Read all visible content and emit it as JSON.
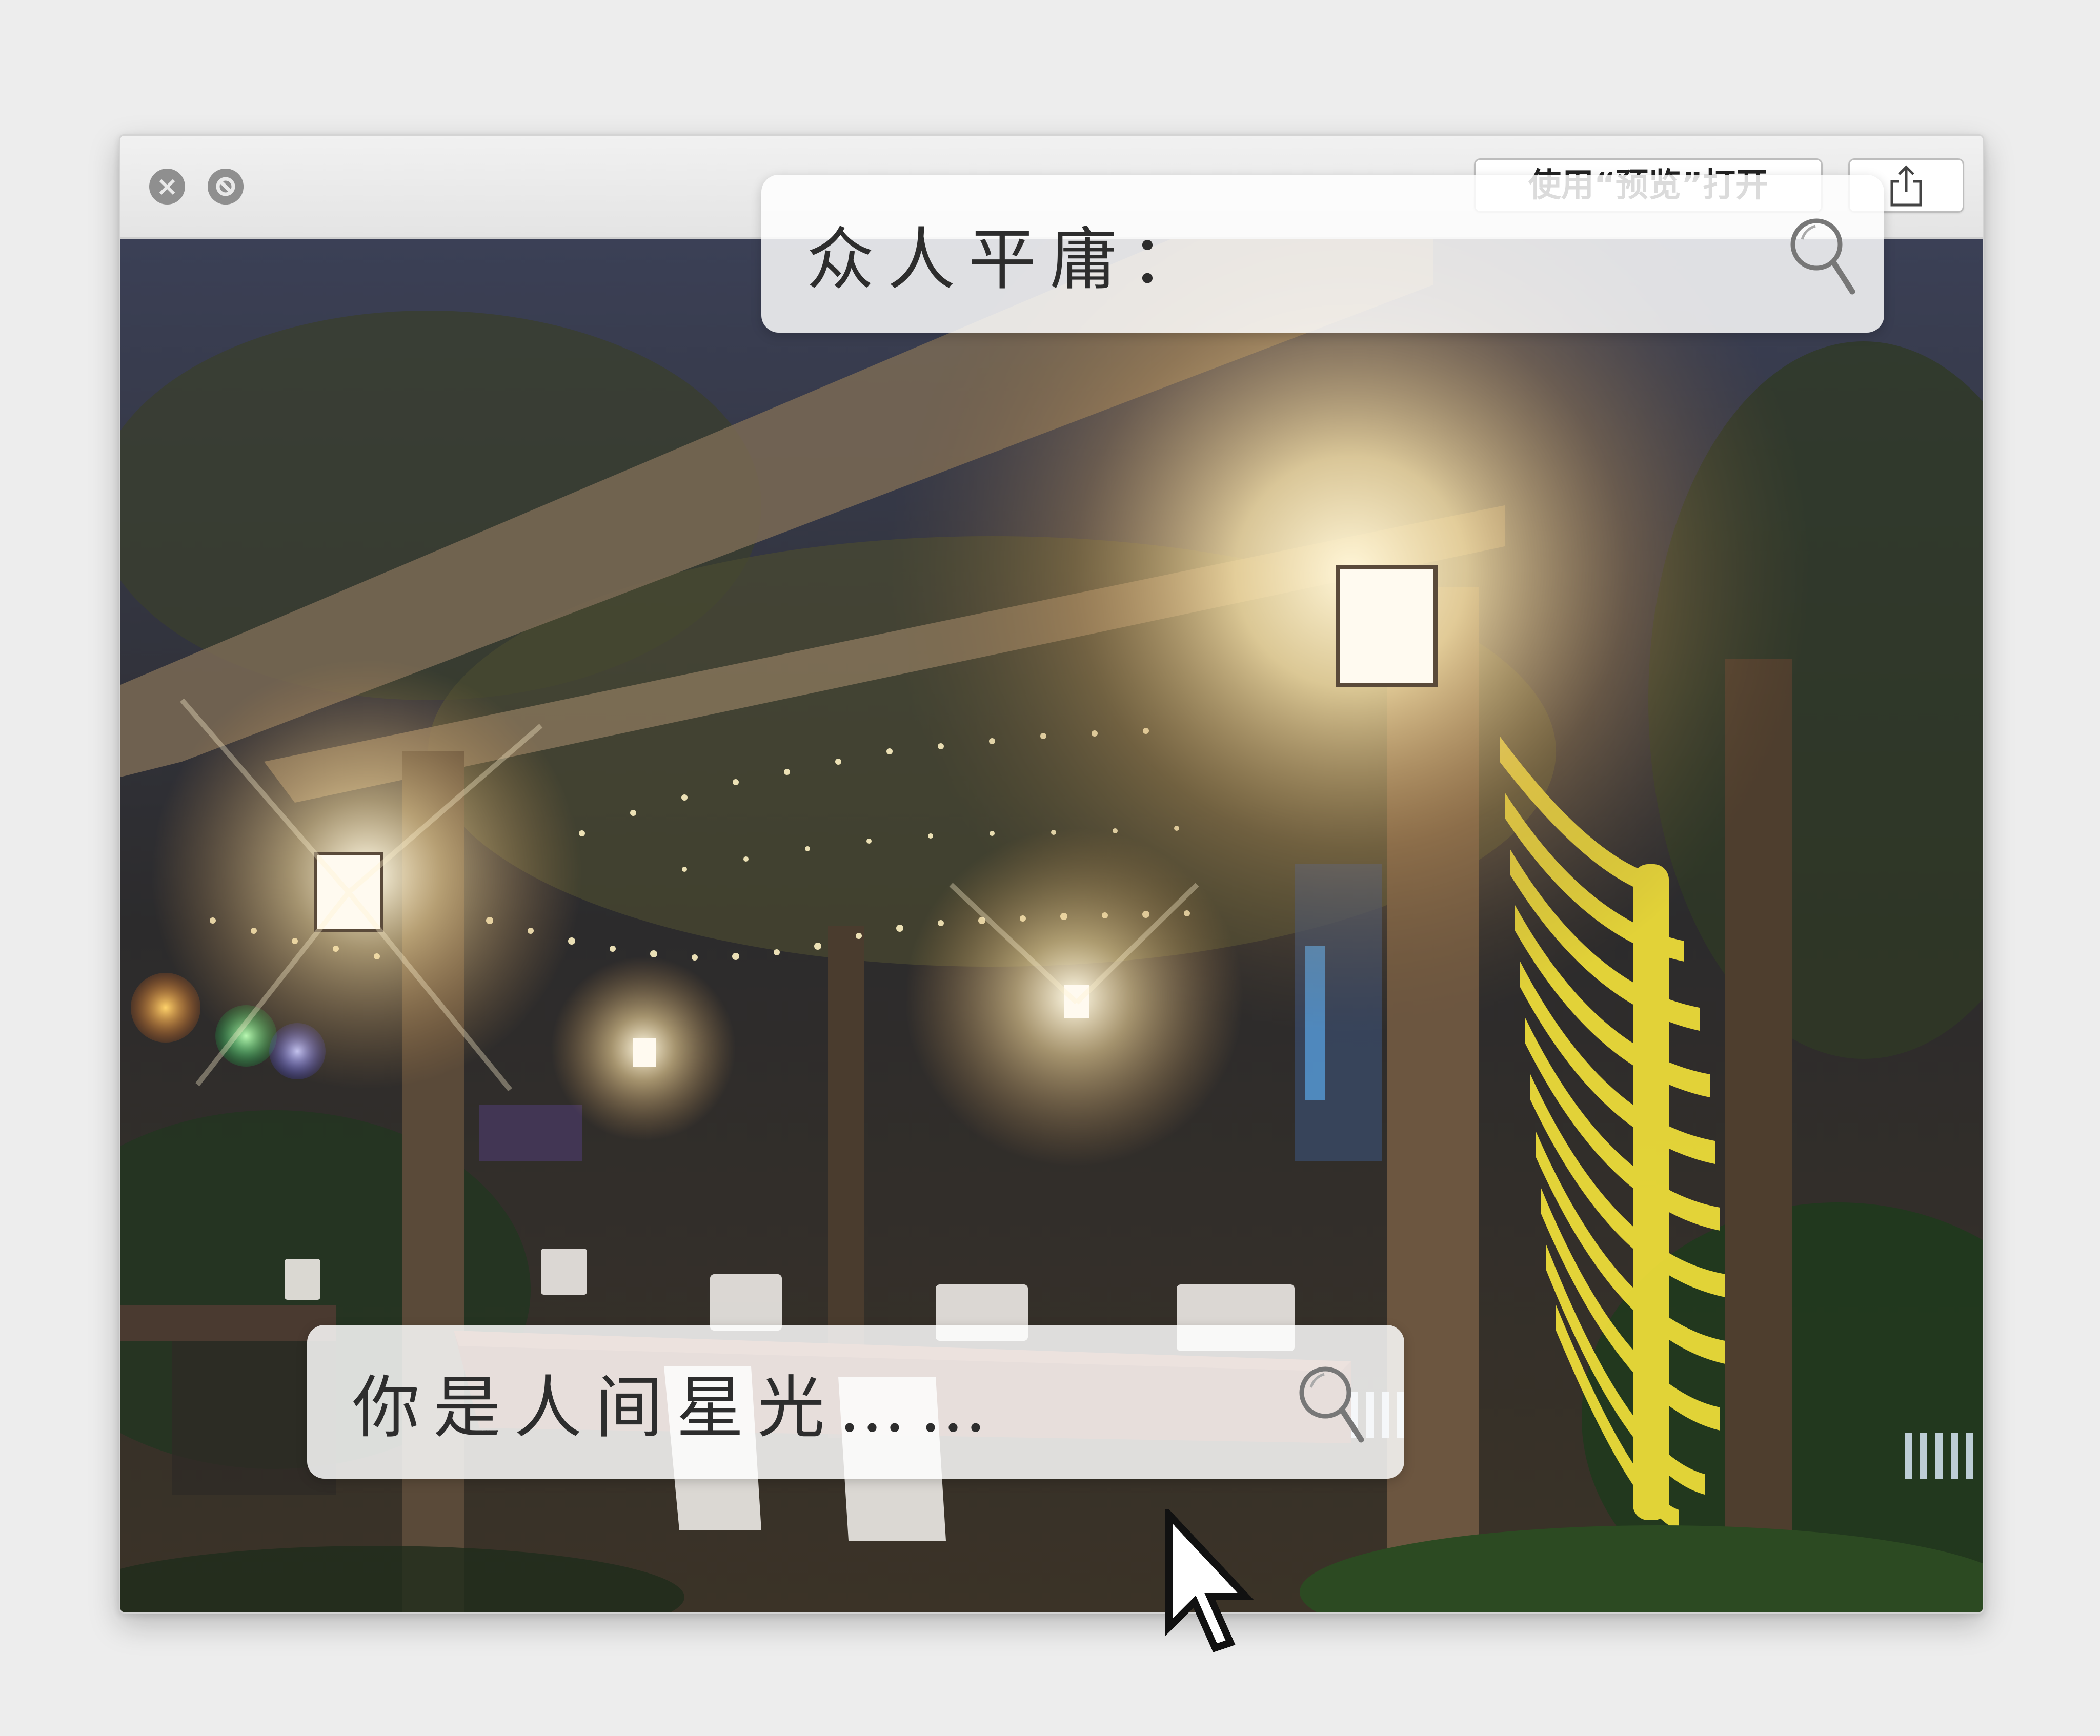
{
  "window": {
    "close_glyph": "×",
    "minimize_glyph": "⊘",
    "open_with_preview_label": "使用“预览”打开",
    "share_icon": "share-icon"
  },
  "photo": {
    "description_icon": "night-garden-pergola-photo"
  },
  "search_top": {
    "text": "众人平庸：",
    "icon": "search-icon"
  },
  "search_bottom": {
    "text": "你是人间星光……",
    "icon": "search-icon"
  },
  "pointer": {
    "icon": "pixel-arrow-cursor-icon"
  }
}
